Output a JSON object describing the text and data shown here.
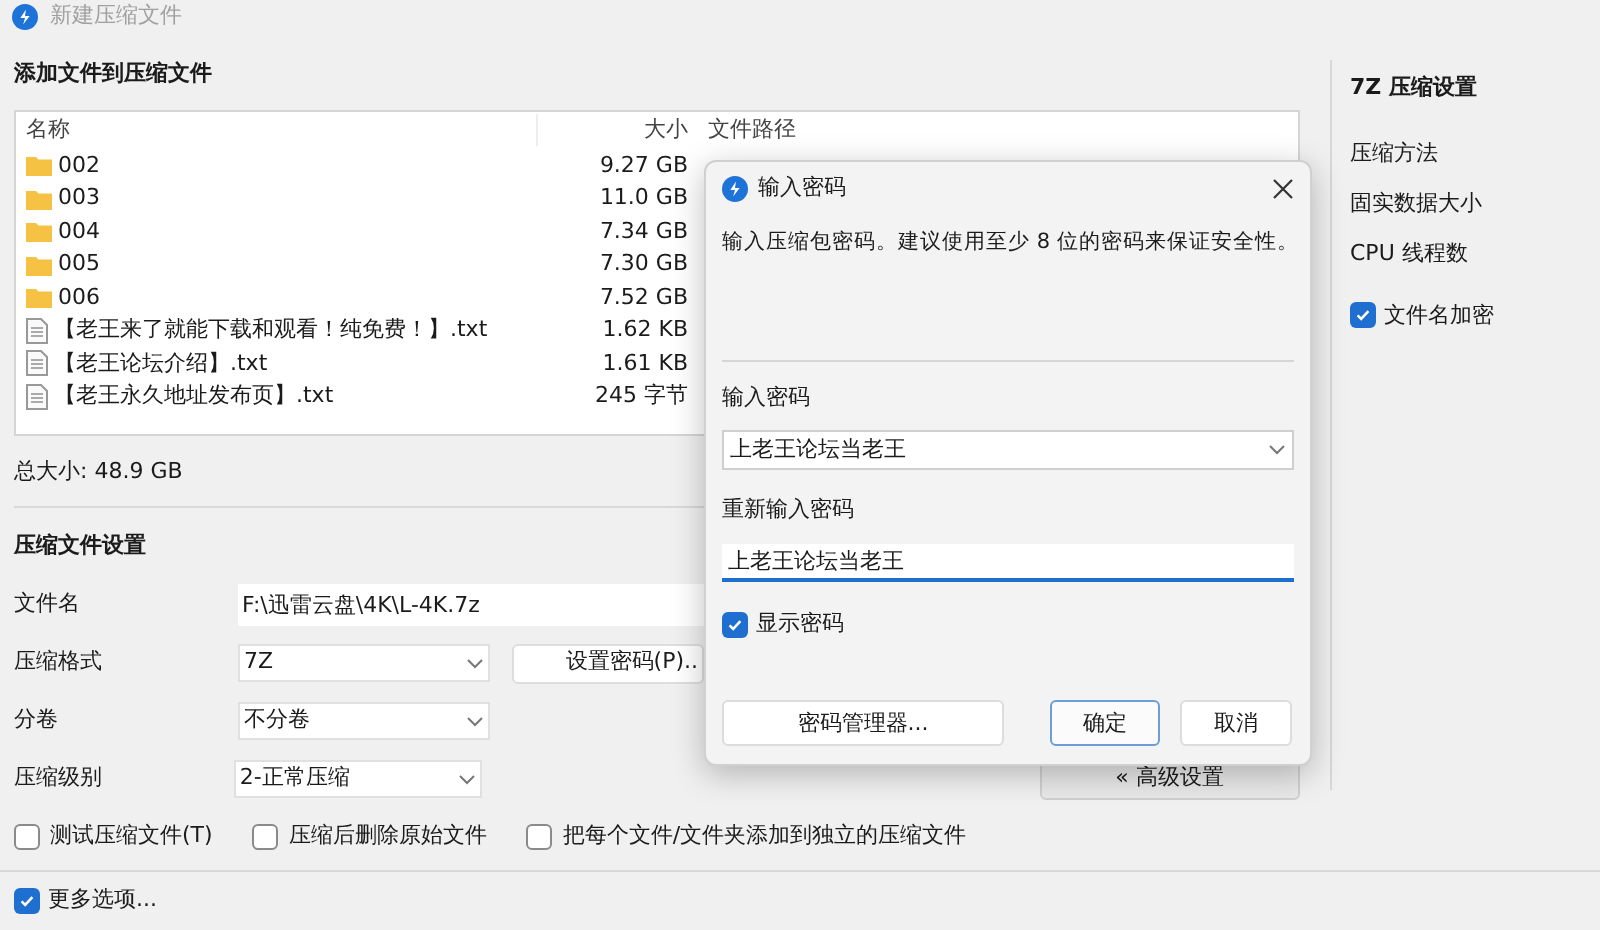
{
  "window": {
    "title": "新建压缩文件"
  },
  "file_list": {
    "heading": "添加文件到压缩文件",
    "columns": [
      "名称",
      "大小",
      "文件路径"
    ],
    "rows": [
      {
        "kind": "folder",
        "name": "002",
        "size": "9.27 GB"
      },
      {
        "kind": "folder",
        "name": "003",
        "size": "11.0 GB"
      },
      {
        "kind": "folder",
        "name": "004",
        "size": "7.34 GB"
      },
      {
        "kind": "folder",
        "name": "005",
        "size": "7.30 GB"
      },
      {
        "kind": "folder",
        "name": "006",
        "size": "7.52 GB"
      },
      {
        "kind": "file",
        "name": "【老王来了就能下载和观看！纯免费！】.txt",
        "size": "1.62 KB"
      },
      {
        "kind": "file",
        "name": "【老王论坛介绍】.txt",
        "size": "1.61 KB"
      },
      {
        "kind": "file",
        "name": "【老王永久地址发布页】.txt",
        "size": "245 字节"
      }
    ]
  },
  "total_size": "总大小: 48.9 GB",
  "settings": {
    "heading": "压缩文件设置",
    "filename": {
      "label": "文件名",
      "value": "F:\\迅雷云盘\\4K\\L-4K.7z"
    },
    "selects": [
      {
        "label": "压缩格式",
        "value": "7Z"
      },
      {
        "label": "分卷",
        "value": "不分卷"
      },
      {
        "label": "压缩级别",
        "value": "2-正常压缩"
      }
    ],
    "password_button": "设置密码(P)..",
    "options": [
      {
        "label": "测试压缩文件(T)",
        "checked": false
      },
      {
        "label": "压缩后删除原始文件",
        "checked": false
      },
      {
        "label": "把每个文件/文件夹添加到独立的压缩文件",
        "checked": false
      }
    ],
    "advanced_button": "« 高级设置"
  },
  "more_options": {
    "label": "更多选项...",
    "checked": true
  },
  "right_panel": {
    "heading": "7Z 压缩设置",
    "items": [
      "压缩方法",
      "固实数据大小",
      "CPU 线程数"
    ],
    "encrypt_names": {
      "label": "文件名加密",
      "checked": true
    }
  },
  "dialog": {
    "title": "输入密码",
    "description": "输入压缩包密码。建议使用至少 8 位的密码来保证安全性。",
    "password_label": "输入密码",
    "password_value": "上老王论坛当老王",
    "confirm_label": "重新输入密码",
    "confirm_value": "上老王论坛当老王",
    "confirm_focused": true,
    "show_password": {
      "label": "显示密码",
      "checked": true
    },
    "buttons": [
      {
        "label": "密码管理器...",
        "kind": "manager"
      },
      {
        "label": "确定",
        "kind": "primary"
      },
      {
        "label": "取消",
        "kind": "secondary"
      }
    ]
  }
}
